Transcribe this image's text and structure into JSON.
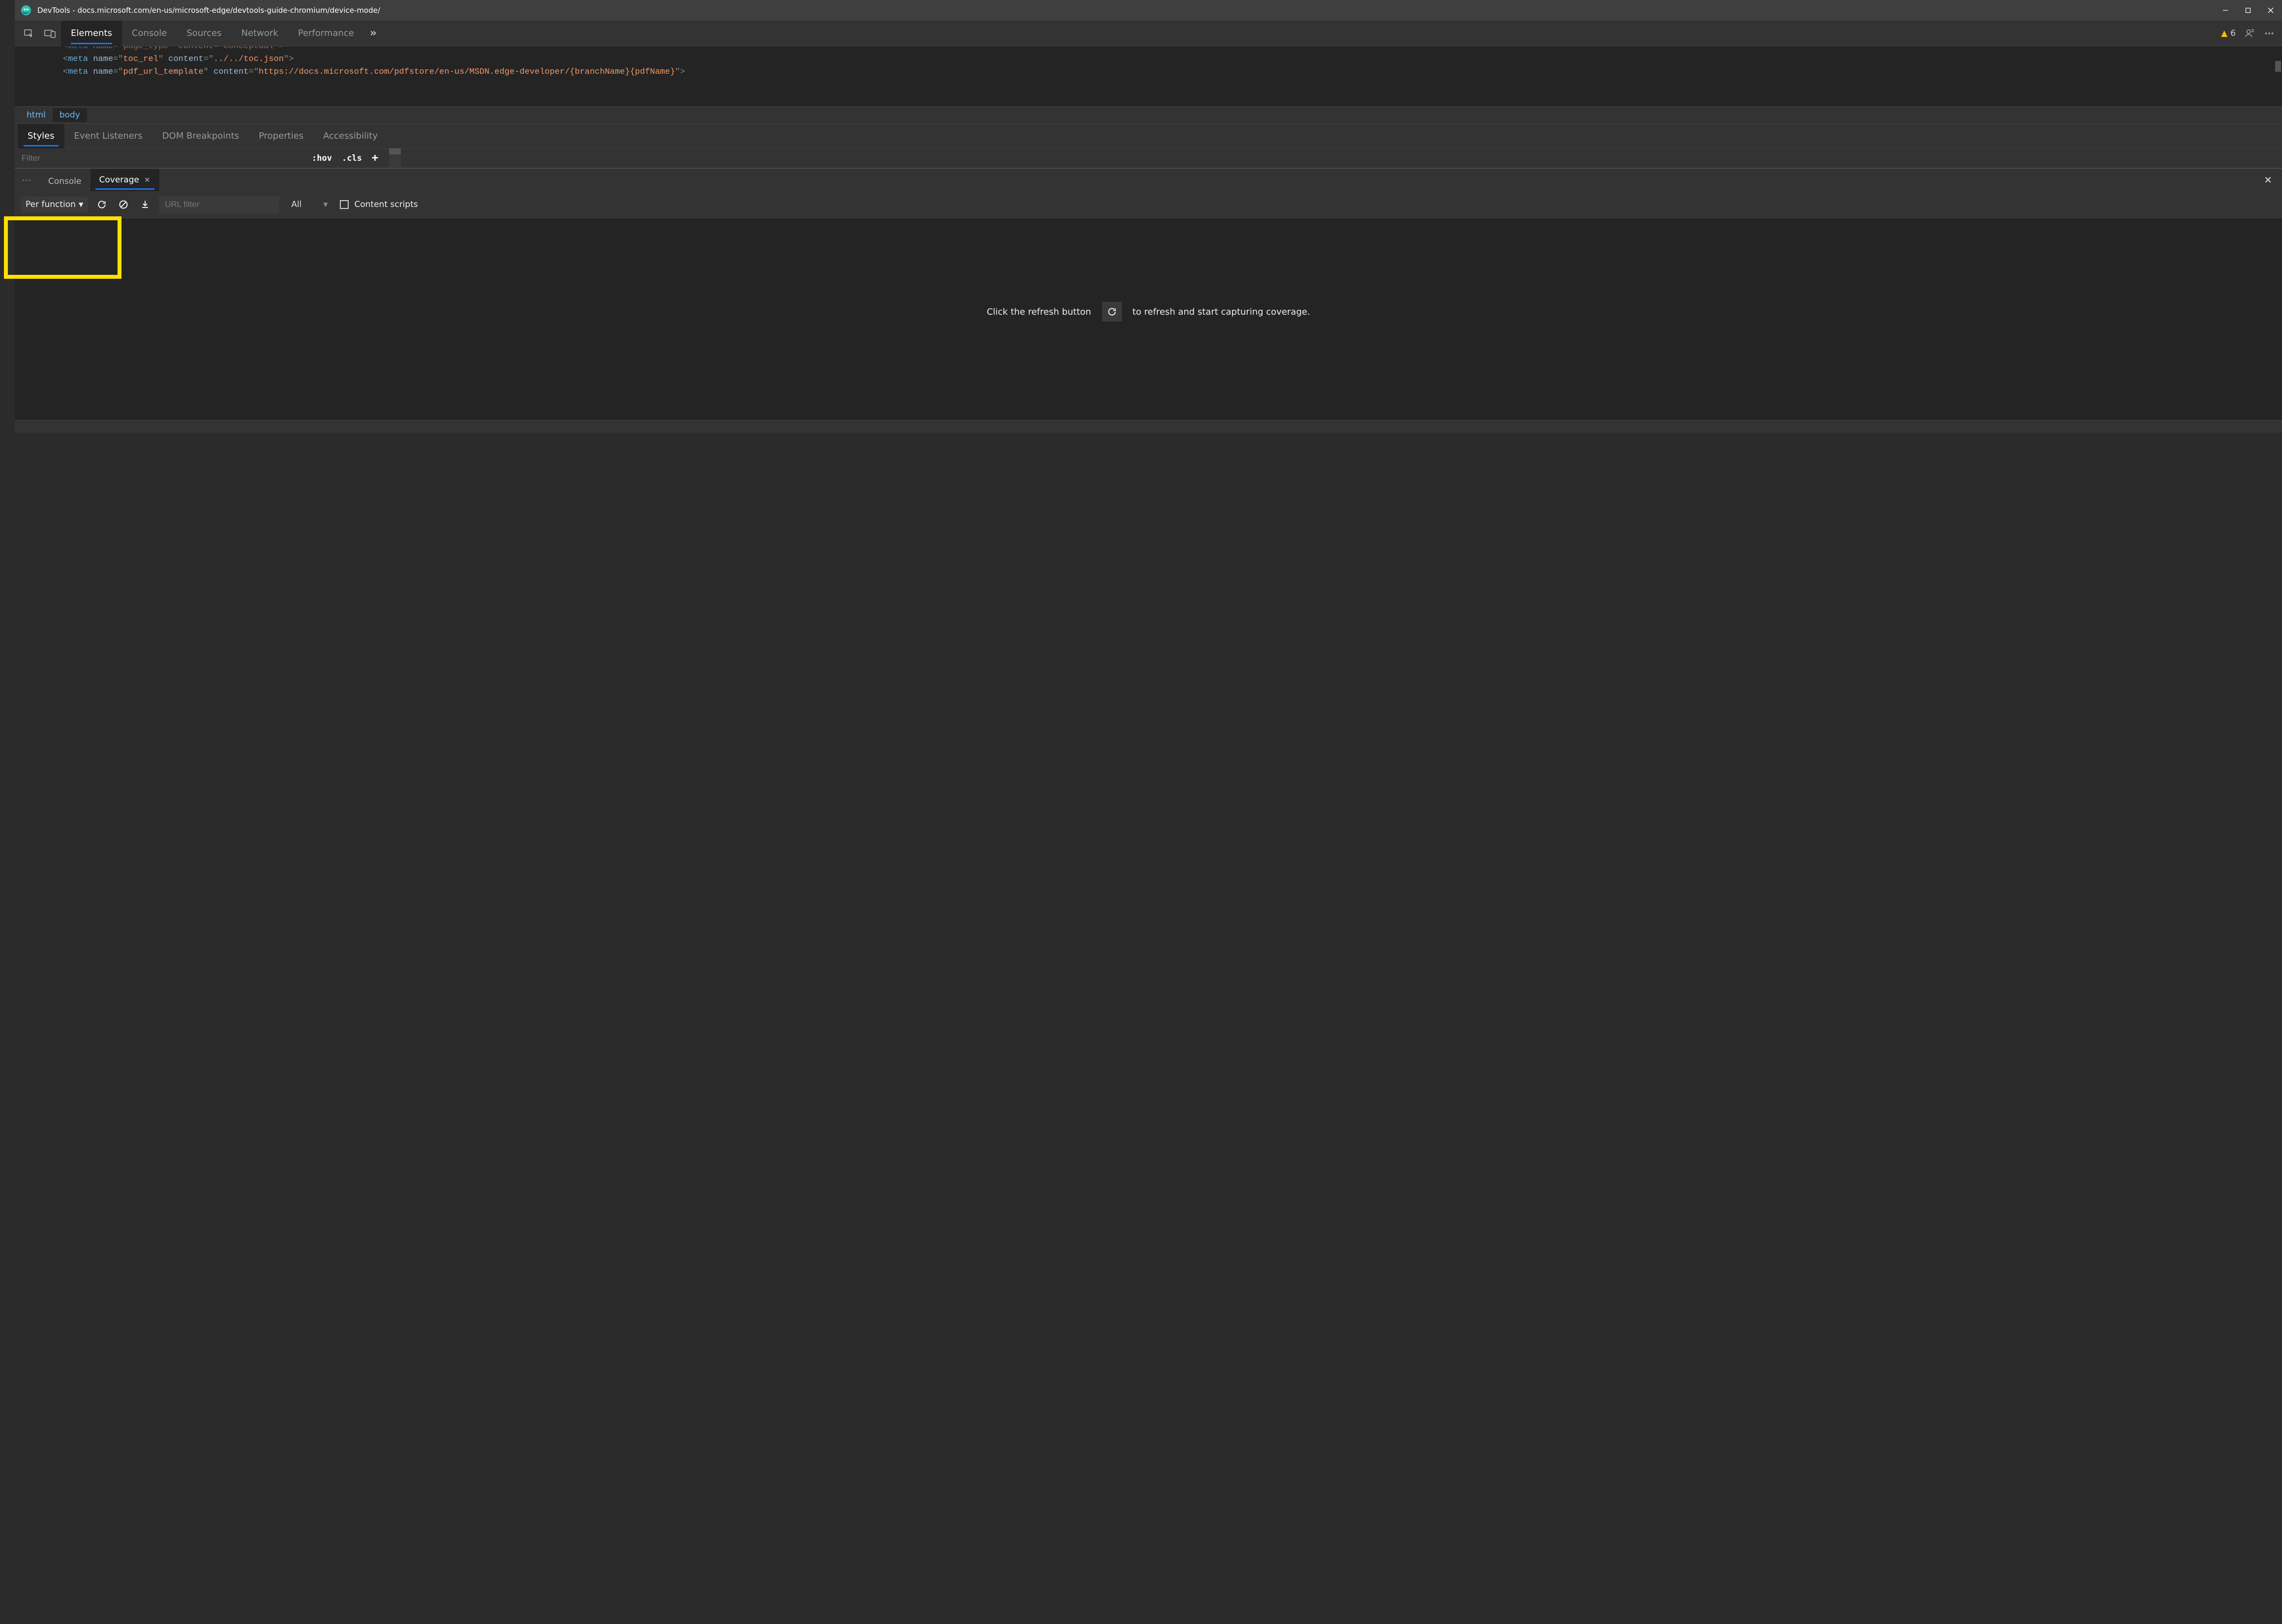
{
  "window": {
    "title": "DevTools - docs.microsoft.com/en-us/microsoft-edge/devtools-guide-chromium/device-mode/"
  },
  "mainTabs": {
    "elements": "Elements",
    "console": "Console",
    "sources": "Sources",
    "network": "Network",
    "performance": "Performance"
  },
  "issues": {
    "count": "6"
  },
  "dom": {
    "line0": {
      "open": "<",
      "tag": "meta",
      "sp": " ",
      "a1": "name",
      "eq": "=",
      "q": "\"",
      "v1": "page_type",
      "a2": "content",
      "v2": "conceptual",
      "close": ">"
    },
    "line1": {
      "open": "<",
      "tag": "meta",
      "sp": " ",
      "a1": "name",
      "eq": "=",
      "q": "\"",
      "v1": "toc_rel",
      "a2": "content",
      "v2": "../../toc.json",
      "close": ">"
    },
    "line2": {
      "open": "<",
      "tag": "meta",
      "sp": " ",
      "a1": "name",
      "eq": "=",
      "q": "\"",
      "v1": "pdf_url_template",
      "a2": "content",
      "v2": "https://docs.microsoft.com/pdfstore/en-us/MSDN.edge-developer/{branchName}{pdfName}",
      "close": ">"
    }
  },
  "breadcrumb": {
    "html": "html",
    "body": "body"
  },
  "stylesTabs": {
    "styles": "Styles",
    "eventListeners": "Event Listeners",
    "domBreakpoints": "DOM Breakpoints",
    "properties": "Properties",
    "accessibility": "Accessibility"
  },
  "stylesToolbar": {
    "filterPlaceholder": "Filter",
    "hov": ":hov",
    "cls": ".cls"
  },
  "drawer": {
    "console": "Console",
    "coverage": "Coverage"
  },
  "coverage": {
    "perFunction": "Per function",
    "urlFilterPlaceholder": "URL filter",
    "typeAll": "All",
    "contentScripts": "Content scripts",
    "hintLeft": "Click the refresh button",
    "hintRight": "to refresh and start capturing coverage."
  }
}
